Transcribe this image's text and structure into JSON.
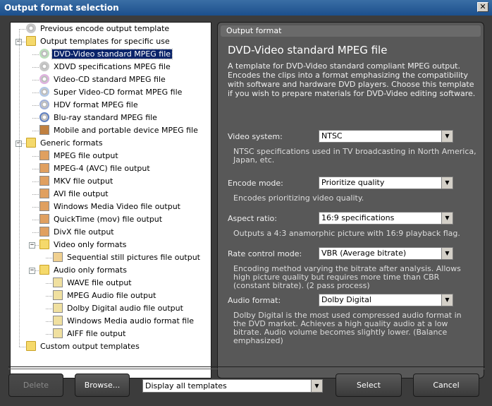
{
  "window": {
    "title": "Output format selection",
    "close_glyph": "✕"
  },
  "tree": {
    "items": [
      {
        "label": "Previous encode output template",
        "icon": "disc-icon"
      },
      {
        "label": "Output templates for specific use",
        "icon": "folder-icon"
      },
      {
        "label": "DVD-Video standard MPEG file",
        "icon": "dvd-disc-icon"
      },
      {
        "label": "XDVD specifications MPEG file",
        "icon": "disc-icon"
      },
      {
        "label": "Video-CD standard MPEG file",
        "icon": "vcd-disc-icon"
      },
      {
        "label": "Super Video-CD format MPEG file",
        "icon": "svcd-disc-icon"
      },
      {
        "label": "HDV format MPEG file",
        "icon": "hdv-disc-icon"
      },
      {
        "label": "Blu-ray standard MPEG file",
        "icon": "bluray-disc-icon"
      },
      {
        "label": "Mobile and portable device MPEG file",
        "icon": "mobile-device-icon"
      },
      {
        "label": "Generic formats",
        "icon": "folder-icon"
      },
      {
        "label": "MPEG file output",
        "icon": "film-file-icon"
      },
      {
        "label": "MPEG-4 (AVC) file output",
        "icon": "film-file-icon"
      },
      {
        "label": "MKV file output",
        "icon": "film-file-icon"
      },
      {
        "label": "AVI file output",
        "icon": "film-file-icon"
      },
      {
        "label": "Windows Media Video file output",
        "icon": "film-file-icon"
      },
      {
        "label": "QuickTime (mov) file output",
        "icon": "film-file-icon"
      },
      {
        "label": "DivX file output",
        "icon": "film-file-icon"
      },
      {
        "label": "Video only formats",
        "icon": "folder-icon"
      },
      {
        "label": "Sequential still pictures file output",
        "icon": "picture-file-icon"
      },
      {
        "label": "Audio only formats",
        "icon": "folder-icon"
      },
      {
        "label": "WAVE file output",
        "icon": "audio-file-icon"
      },
      {
        "label": "MPEG Audio file output",
        "icon": "audio-file-icon"
      },
      {
        "label": "Dolby Digital audio file output",
        "icon": "audio-file-icon"
      },
      {
        "label": "Windows Media audio format file",
        "icon": "audio-file-icon"
      },
      {
        "label": "AIFF file output",
        "icon": "audio-file-icon"
      },
      {
        "label": "Custom output templates",
        "icon": "folder-icon"
      }
    ],
    "expand_glyph": "−"
  },
  "panel": {
    "header": "Output format",
    "title": "DVD-Video standard MPEG file",
    "description": "A template for DVD-Video standard compliant MPEG output. Encodes the clips into a format emphasizing the compatibility with software and hardware DVD players. Choose this template if you wish to prepare materials for DVD-Video editing software.",
    "video_system": {
      "label": "Video system:",
      "value": "NTSC",
      "desc": "NTSC specifications used in TV broadcasting in North America, Japan, etc."
    },
    "encode_mode": {
      "label": "Encode mode:",
      "value": "Prioritize quality",
      "desc": "Encodes prioritizing video quality."
    },
    "aspect_ratio": {
      "label": "Aspect ratio:",
      "value": "16:9 specifications",
      "desc": "Outputs a 4:3 anamorphic picture with 16:9 playback flag."
    },
    "rate_control": {
      "label": "Rate control mode:",
      "value": "VBR (Average bitrate)",
      "desc": "Encoding method varying the bitrate after analysis. Allows high picture quality but requires more time than CBR (constant bitrate). (2 pass process)"
    },
    "audio_format": {
      "label": "Audio format:",
      "value": "Dolby Digital",
      "desc": "Dolby Digital is the most used compressed audio format in the DVD market. Achieves a high quality audio at a low bitrate. Audio volume becomes slightly lower. (Balance emphasized)"
    },
    "dropdown_glyph": "▼"
  },
  "footer": {
    "delete": "Delete",
    "browse": "Browse...",
    "filter_value": "Display all templates",
    "select": "Select",
    "cancel": "Cancel"
  },
  "colors": {
    "selection": "#0a246a",
    "panel_bg": "#585858",
    "dialog_bg": "#3c3c3c"
  }
}
